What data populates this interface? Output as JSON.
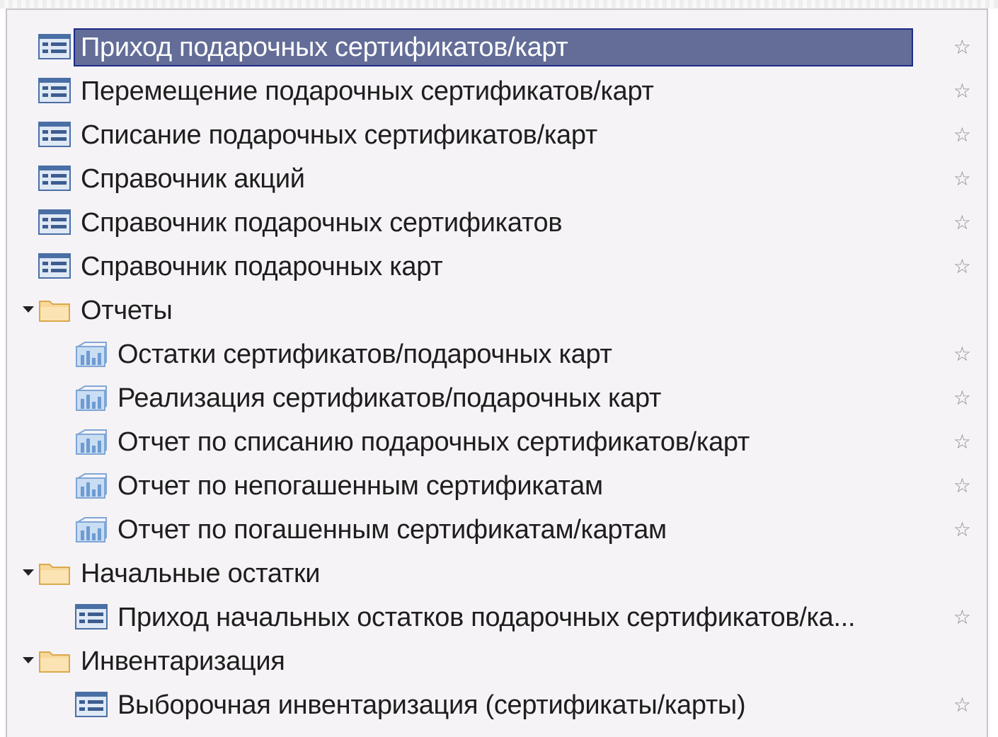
{
  "tree": {
    "items": [
      {
        "label": "Приход подарочных сертификатов/карт",
        "type": "document",
        "selected": true,
        "favorite": true
      },
      {
        "label": "Перемещение подарочных сертификатов/карт",
        "type": "document",
        "favorite": true
      },
      {
        "label": "Списание подарочных сертификатов/карт",
        "type": "document",
        "favorite": true
      },
      {
        "label": "Справочник акций",
        "type": "document",
        "favorite": true
      },
      {
        "label": "Справочник подарочных сертификатов",
        "type": "document",
        "favorite": true
      },
      {
        "label": "Справочник подарочных карт",
        "type": "document",
        "favorite": true
      },
      {
        "label": "Отчеты",
        "type": "folder",
        "expanded": true
      },
      {
        "label": "Остатки сертификатов/подарочных карт",
        "type": "report",
        "favorite": true
      },
      {
        "label": "Реализация сертификатов/подарочных карт",
        "type": "report",
        "favorite": true
      },
      {
        "label": "Отчет по списанию подарочных сертификатов/карт",
        "type": "report",
        "favorite": true
      },
      {
        "label": "Отчет по непогашенным сертификатам",
        "type": "report",
        "favorite": true
      },
      {
        "label": "Отчет по погашенным сертификатам/картам",
        "type": "report",
        "favorite": true
      },
      {
        "label": "Начальные остатки",
        "type": "folder",
        "expanded": true
      },
      {
        "label": "Приход начальных остатков подарочных сертификатов/ка...",
        "type": "document",
        "favorite": true
      },
      {
        "label": "Инвентаризация",
        "type": "folder",
        "expanded": true
      },
      {
        "label": "Выборочная инвентаризация (сертификаты/карты)",
        "type": "document",
        "favorite": true
      }
    ],
    "star_glyph": "☆",
    "colors": {
      "selection_bg": "#636d97",
      "selection_border": "#1c2a8a",
      "panel_bg": "#f6f3f6"
    }
  }
}
